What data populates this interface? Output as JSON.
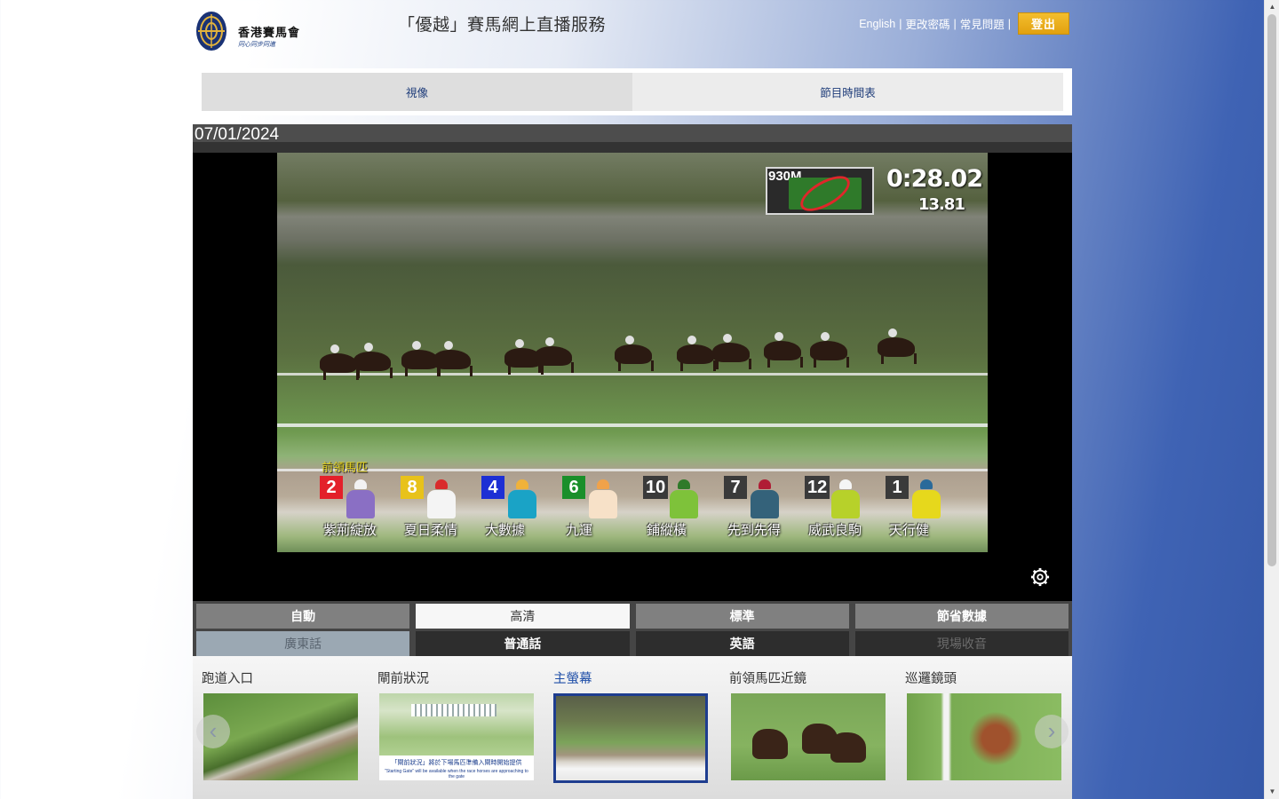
{
  "header": {
    "logo_name": "香港賽馬會",
    "logo_slogan": "同心同步同進",
    "site_title": "「優越」賽馬網上直播服務",
    "nav": [
      "English",
      "更改密碼",
      "常見問題"
    ],
    "nav_sep": "|",
    "logout_label": "登出"
  },
  "tabs": [
    {
      "label": "視像",
      "active": true
    },
    {
      "label": "節目時間表",
      "active": false
    }
  ],
  "date": "07/01/2024",
  "video": {
    "distance": "930M",
    "elapsed_time": "0:28.02",
    "split_time": "13.81",
    "leader_label": "前領馬匹",
    "runners": [
      {
        "number": "2",
        "name": "紫荊綻放",
        "num_color": "#e3202a",
        "cap": "#f2f2f2",
        "body": "#8a6fc4"
      },
      {
        "number": "8",
        "name": "夏日柔情",
        "num_color": "#e8c21a",
        "cap": "#d92b2b",
        "body": "#f4f4f4"
      },
      {
        "number": "4",
        "name": "大數據",
        "num_color": "#1d2fd4",
        "cap": "#f0b23a",
        "body": "#1aa3c6"
      },
      {
        "number": "6",
        "name": "九運",
        "num_color": "#1a8f2a",
        "cap": "#f0a24a",
        "body": "#f7e1c8"
      },
      {
        "number": "10",
        "name": "鋪縱橫",
        "num_color": "#3a3a3a",
        "cap": "#2f7a2a",
        "body": "#7ec23a"
      },
      {
        "number": "7",
        "name": "先到先得",
        "num_color": "#3a3a3a",
        "cap": "#b01d35",
        "body": "#34627a"
      },
      {
        "number": "12",
        "name": "威武良駒",
        "num_color": "#3a3a3a",
        "cap": "#f5f5f5",
        "body": "#b7d12a"
      },
      {
        "number": "1",
        "name": "天行健",
        "num_color": "#3a3a3a",
        "cap": "#2a6a9a",
        "body": "#e6d81c"
      }
    ],
    "settings_icon": "gear-icon"
  },
  "quality": [
    {
      "label": "自動",
      "state": "grey"
    },
    {
      "label": "高清",
      "state": "white"
    },
    {
      "label": "標準",
      "state": "grey"
    },
    {
      "label": "節省數據",
      "state": "grey"
    }
  ],
  "audio": [
    {
      "label": "廣東話",
      "state": "blue"
    },
    {
      "label": "普通話",
      "state": "dark"
    },
    {
      "label": "英語",
      "state": "dark"
    },
    {
      "label": "現場收音",
      "state": "disabled"
    }
  ],
  "cameras": [
    {
      "label": "跑道入口",
      "active": false
    },
    {
      "label": "閘前狀況",
      "active": false,
      "ticker_cn": "「閘前狀況」將於下場馬匹準備入閘時開始提供",
      "ticker_en": "\"Starting Gate\" will be available when the race horses are approaching to the gate"
    },
    {
      "label": "主螢幕",
      "active": true
    },
    {
      "label": "前領馬匹近鏡",
      "active": false
    },
    {
      "label": "巡邏鏡頭",
      "active": false
    }
  ]
}
